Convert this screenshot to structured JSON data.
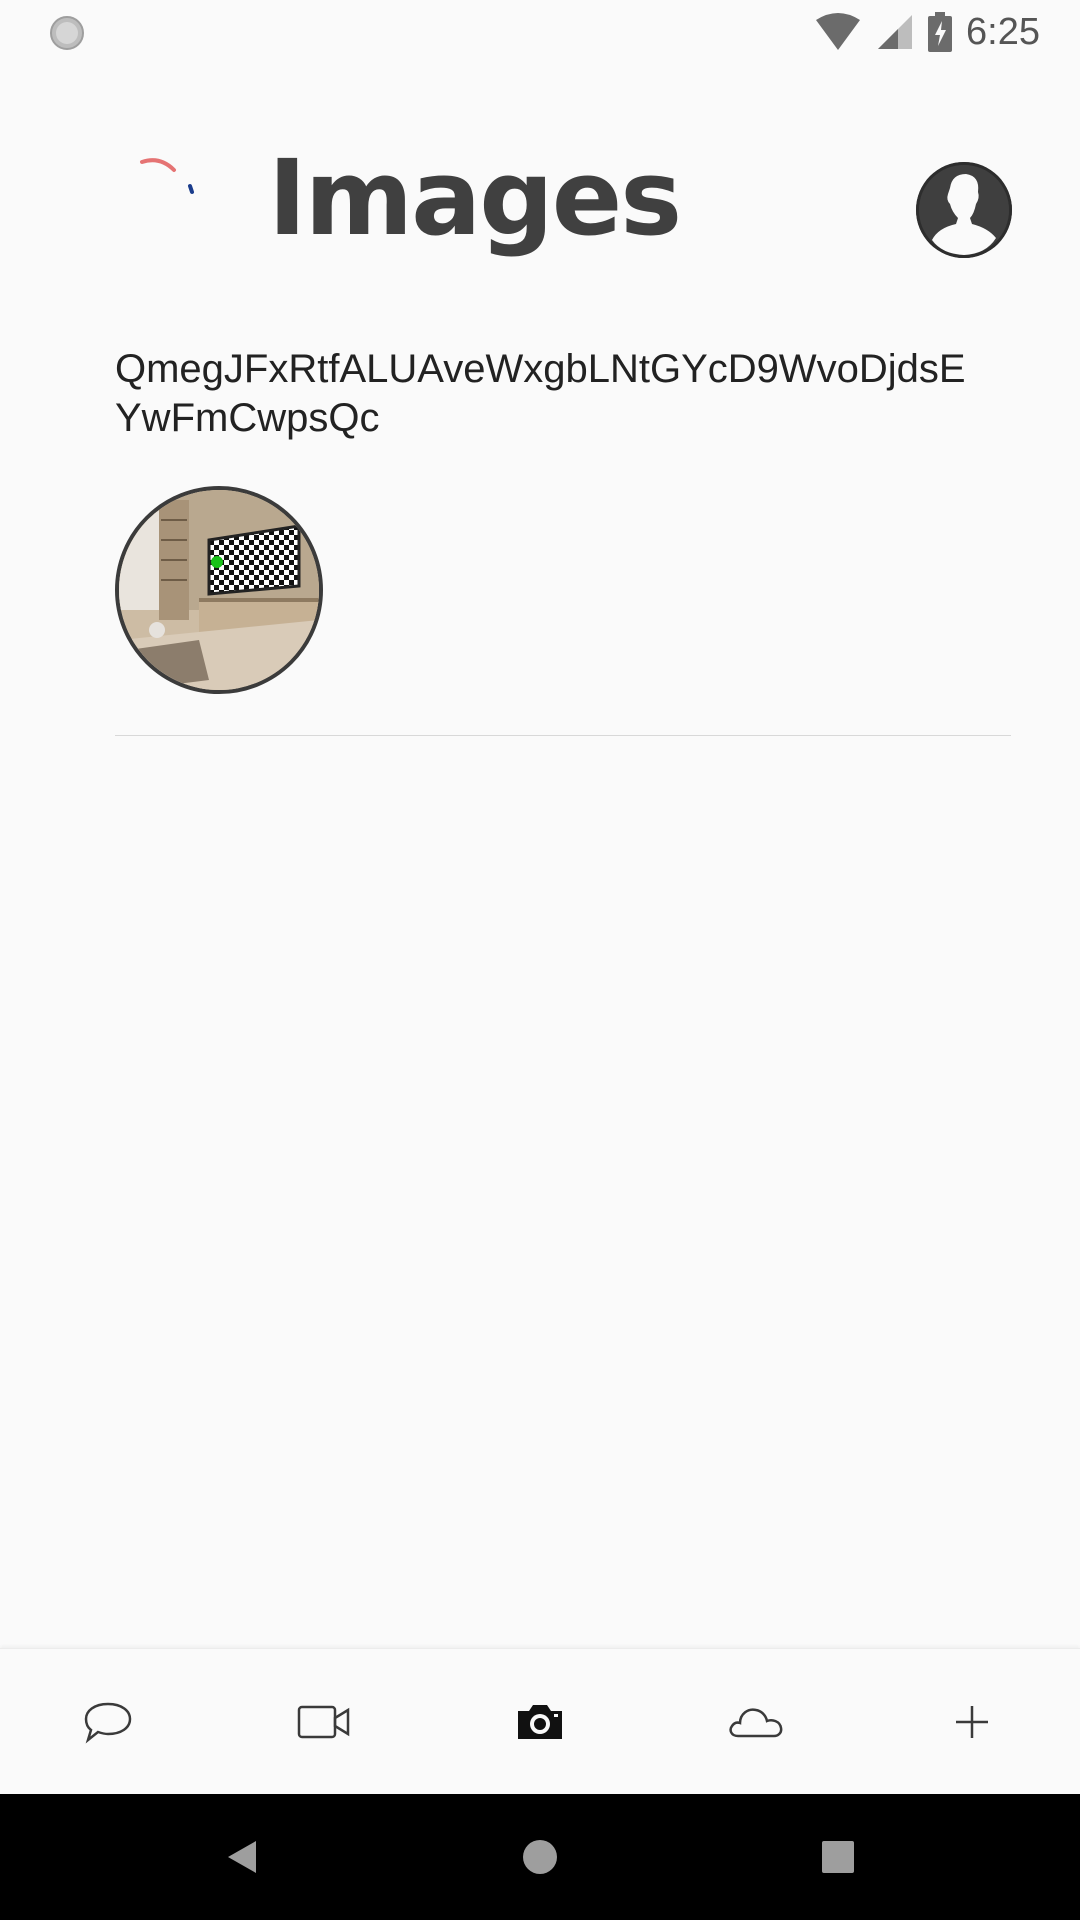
{
  "status_bar": {
    "time": "6:25",
    "icons": [
      "loading-indicator-icon",
      "wifi-icon",
      "cell-signal-icon",
      "battery-charging-icon"
    ]
  },
  "header": {
    "title": "Images",
    "spinner_colors": [
      "#e57373",
      "#1a3c8c"
    ]
  },
  "album": {
    "name": "QmegJFxRtfALUAveWxgbLNtGYcD9WvoDjdsEYwFmCwpsQc",
    "thumbnail_icon": "room-tv-photo"
  },
  "bottom_nav": {
    "items": [
      {
        "icon": "chat-bubble-icon",
        "selected": false
      },
      {
        "icon": "video-camera-icon",
        "selected": false
      },
      {
        "icon": "photo-camera-icon",
        "selected": true
      },
      {
        "icon": "cloud-icon",
        "selected": false
      },
      {
        "icon": "plus-icon",
        "selected": false
      }
    ]
  },
  "system_nav": {
    "buttons": [
      "back-icon",
      "home-icon",
      "recents-icon"
    ]
  }
}
